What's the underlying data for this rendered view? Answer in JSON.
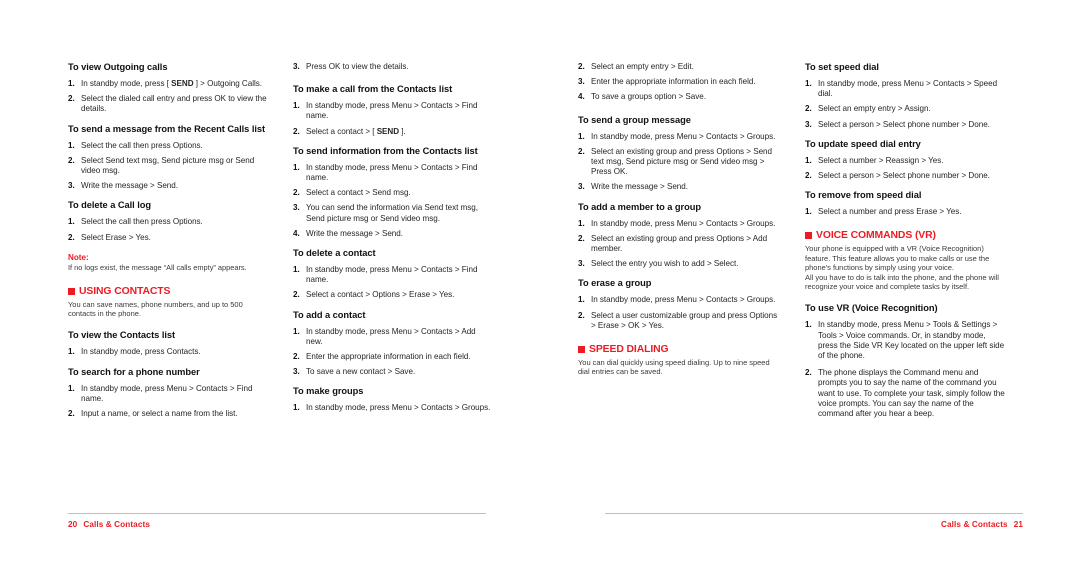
{
  "document": {
    "type": "phone-user-manual-spread",
    "accent_color": "#ED1C24",
    "rule_color": "#F4A9A9",
    "text_color": "#262626"
  },
  "columns": {
    "col1": {
      "blocks": [
        {
          "heading": "To view Outgoing calls",
          "steps": [
            {
              "num": "1.",
              "text_before": "In standby mode, press [ ",
              "kbd": "SEND",
              "text_after": " ] > Outgoing Calls."
            },
            {
              "num": "2.",
              "text": "Select the dialed call entry and press OK to view the details."
            }
          ]
        },
        {
          "heading": "To send a message from the Recent Calls list",
          "steps": [
            {
              "num": "1.",
              "text": "Select the call then press Options."
            },
            {
              "num": "2.",
              "text": "Select Send text msg, Send picture msg or Send video msg."
            },
            {
              "num": "3.",
              "text": "Write the message > Send."
            }
          ]
        },
        {
          "heading": "To delete a Call log",
          "steps": [
            {
              "num": "1.",
              "text": "Select the call then press Options."
            },
            {
              "num": "2.",
              "text": "Select Erase > Yes."
            }
          ]
        }
      ],
      "note": {
        "label": "Note:",
        "body": "If no logs exist, the message “All calls empty” appears."
      },
      "chapter": {
        "title": "USING CONTACTS",
        "body": "You can save names, phone numbers, and up to 500 contacts in the phone."
      },
      "blocks_after": [
        {
          "heading": "To view the Contacts list",
          "steps": [
            {
              "num": "1.",
              "text": "In standby mode, press Contacts."
            }
          ]
        },
        {
          "heading": "To search for a phone number",
          "steps": [
            {
              "num": "1.",
              "text": "In standby mode, press Menu > Contacts > Find name."
            },
            {
              "num": "2.",
              "text": "Input a name, or select a name from the list."
            }
          ]
        }
      ]
    },
    "col2": {
      "lead_steps": [
        {
          "num": "3.",
          "text": "Press OK to view the details."
        }
      ],
      "blocks": [
        {
          "heading": "To make a call from the Contacts list",
          "steps": [
            {
              "num": "1.",
              "text": "In standby mode, press Menu > Contacts > Find name."
            },
            {
              "num": "2.",
              "text_before": "Select a contact > [ ",
              "kbd": "SEND",
              "text_after": " ]."
            }
          ]
        },
        {
          "heading": "To send information from the Contacts list",
          "steps": [
            {
              "num": "1.",
              "text": "In standby mode, press Menu > Contacts > Find name."
            },
            {
              "num": "2.",
              "text": "Select a contact > Send msg."
            },
            {
              "num": "3.",
              "text": "You can send the information via Send text msg, Send picture msg or Send video msg."
            },
            {
              "num": "4.",
              "text": "Write the message > Send."
            }
          ]
        },
        {
          "heading": "To delete a contact",
          "steps": [
            {
              "num": "1.",
              "text": "In standby mode, press Menu > Contacts > Find name."
            },
            {
              "num": "2.",
              "text": "Select a contact > Options > Erase > Yes."
            }
          ]
        },
        {
          "heading": "To add a contact",
          "steps": [
            {
              "num": "1.",
              "text": "In standby mode, press Menu > Contacts > Add new."
            },
            {
              "num": "2.",
              "text": "Enter the appropriate information in each field."
            },
            {
              "num": "3.",
              "text": "To save a new contact > Save."
            }
          ]
        },
        {
          "heading": "To make groups",
          "steps": [
            {
              "num": "1.",
              "text": "In standby mode, press Menu > Contacts > Groups."
            }
          ]
        }
      ]
    },
    "col3": {
      "lead_steps": [
        {
          "num": "2.",
          "text": "Select an empty entry > Edit."
        },
        {
          "num": "3.",
          "text": "Enter the appropriate information in each field."
        },
        {
          "num": "4.",
          "text": "To save a groups option > Save."
        }
      ],
      "blocks": [
        {
          "heading": "To send a group message",
          "steps": [
            {
              "num": "1.",
              "text": "In standby mode, press Menu > Contacts > Groups."
            },
            {
              "num": "2.",
              "text": "Select an existing group and press Options > Send text msg, Send picture msg or Send video msg > Press OK."
            },
            {
              "num": "3.",
              "text": "Write the message > Send."
            }
          ]
        },
        {
          "heading": "To add a member to a group",
          "steps": [
            {
              "num": "1.",
              "text": "In standby mode, press Menu > Contacts > Groups."
            },
            {
              "num": "2.",
              "text": "Select an existing group and press Options > Add member."
            },
            {
              "num": "3.",
              "text": "Select the entry you wish to add > Select."
            }
          ]
        },
        {
          "heading": "To erase a group",
          "steps": [
            {
              "num": "1.",
              "text": "In standby mode, press Menu > Contacts > Groups."
            },
            {
              "num": "2.",
              "text": "Select a user customizable group and press Options > Erase > OK > Yes."
            }
          ]
        }
      ],
      "chapter": {
        "title": "SPEED DIALING",
        "body": "You can dial quickly using speed dialing. Up to nine speed dial entries can be saved."
      }
    },
    "col4": {
      "blocks": [
        {
          "heading": "To set speed dial",
          "steps": [
            {
              "num": "1.",
              "text": "In standby mode, press Menu > Contacts > Speed dial."
            },
            {
              "num": "2.",
              "text": "Select an empty entry > Assign."
            },
            {
              "num": "3.",
              "text": "Select a person > Select phone number > Done."
            }
          ]
        },
        {
          "heading": "To update speed dial entry",
          "steps": [
            {
              "num": "1.",
              "text": "Select a number > Reassign > Yes."
            },
            {
              "num": "2.",
              "text": "Select a person > Select phone number > Done."
            }
          ]
        },
        {
          "heading": "To remove from speed dial",
          "steps": [
            {
              "num": "1.",
              "text": "Select a number and press Erase > Yes."
            }
          ]
        }
      ],
      "chapter": {
        "title": "VOICE COMMANDS (VR)",
        "body": "Your phone is equipped with a VR (Voice Recognition) feature. This feature allows you to make calls or use the phone's functions by simply using your voice.\nAll you have to do is talk into the phone, and the phone will recognize your voice and complete tasks by itself."
      },
      "blocks_after": [
        {
          "heading": "To use VR (Voice Recognition)",
          "steps": [
            {
              "num": "1.",
              "text": "In standby mode, press Menu > Tools & Settings > Tools > Voice commands. Or, in standby mode, press the Side VR Key located on the upper left side of the phone."
            },
            {
              "num": "2.",
              "text": "The phone displays the Command menu and prompts you to say the name of the command you want to use. To complete your task, simply follow the voice prompts. You can say  the name of the command after you hear a beep."
            }
          ]
        }
      ]
    }
  },
  "footer": {
    "left_page_number": "20",
    "left_chapter": "Calls & Contacts",
    "right_chapter": "Calls & Contacts",
    "right_page_number": "21"
  }
}
